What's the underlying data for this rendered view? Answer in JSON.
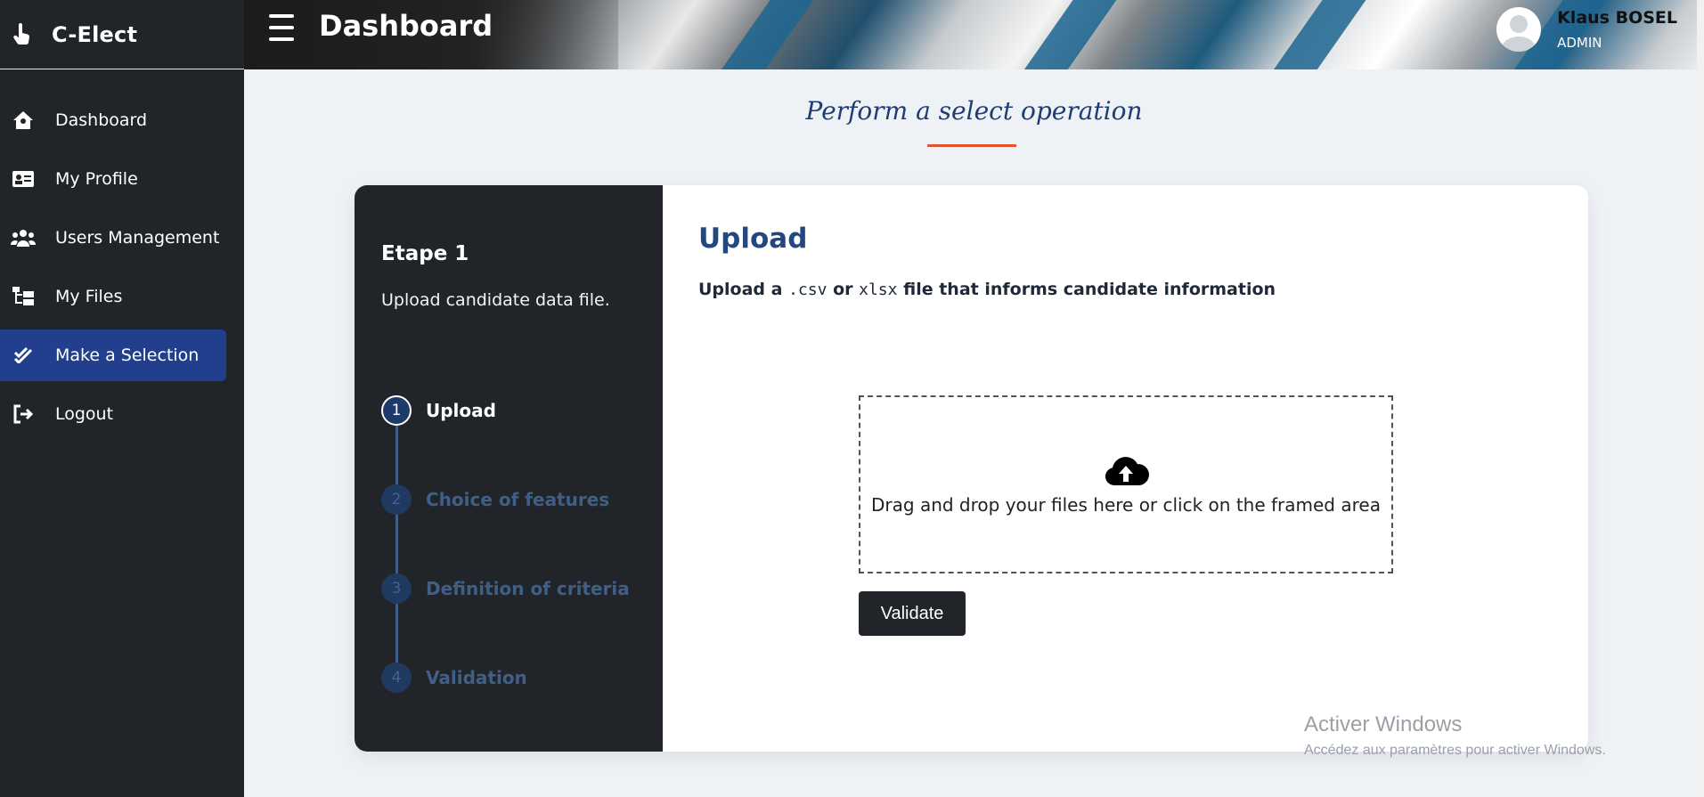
{
  "app": {
    "brand": "C-Elect"
  },
  "header": {
    "title": "Dashboard",
    "user_name": "Klaus BOSEL",
    "user_role": "ADMIN"
  },
  "sidebar": {
    "items": [
      {
        "label": "Dashboard",
        "icon": "home-icon"
      },
      {
        "label": "My Profile",
        "icon": "id-card-icon"
      },
      {
        "label": "Users Management",
        "icon": "users-icon"
      },
      {
        "label": "My Files",
        "icon": "folder-tree-icon"
      },
      {
        "label": "Make a Selection",
        "icon": "check-double-icon",
        "active": true
      },
      {
        "label": "Logout",
        "icon": "logout-icon"
      }
    ]
  },
  "section": {
    "heading": "Perform a select operation"
  },
  "wizard": {
    "etape_title": "Etape 1",
    "etape_desc": "Upload candidate data file.",
    "steps": [
      {
        "num": "1",
        "label": "Upload",
        "active": true
      },
      {
        "num": "2",
        "label": "Choice of features"
      },
      {
        "num": "3",
        "label": "Definition of criteria"
      },
      {
        "num": "4",
        "label": "Validation"
      }
    ]
  },
  "upload": {
    "title": "Upload",
    "desc_prefix": "Upload a",
    "ext1": ".csv",
    "desc_or": "or",
    "ext2": "xlsx",
    "desc_suffix": "file that informs candidate information",
    "dropzone_text": "Drag and drop your files here or click on the framed area",
    "validate_label": "Validate"
  },
  "watermark": {
    "line1": "Activer Windows",
    "line2": "Accédez aux paramètres pour activer Windows."
  },
  "colors": {
    "sidebar": "#212529",
    "active_nav": "#213f8c",
    "accent_underline": "#e0552f",
    "title_blue": "#23477f"
  }
}
